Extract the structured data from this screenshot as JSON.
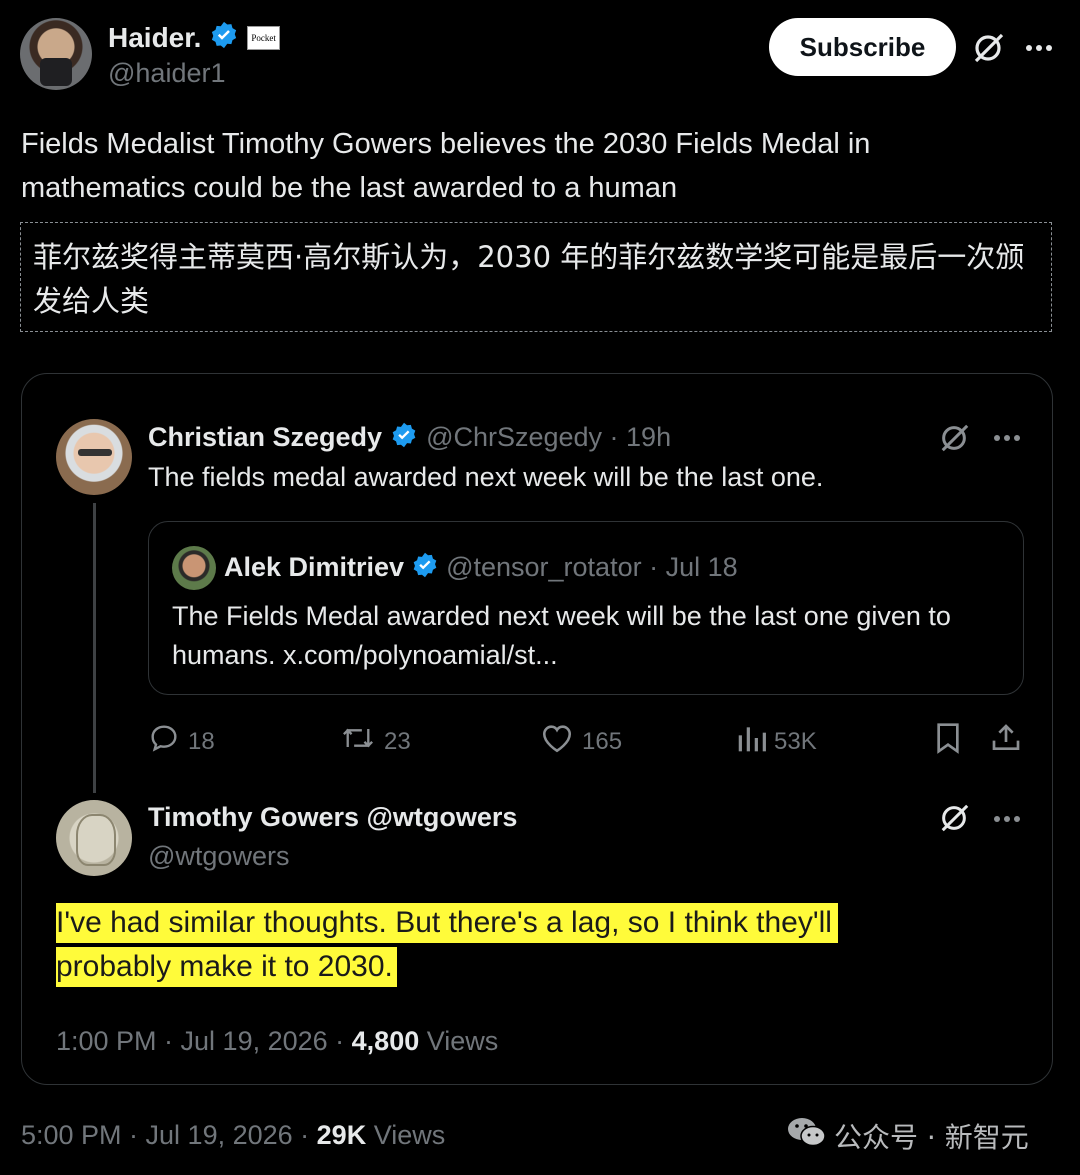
{
  "author": {
    "name": "Haider.",
    "handle": "@haider1",
    "badge_text": "Pocket",
    "subscribe_label": "Subscribe"
  },
  "post": {
    "text_en": "Fields Medalist Timothy Gowers believes the 2030 Fields Medal in mathematics could be the last awarded to a human",
    "text_zh": "菲尔兹奖得主蒂莫西·高尔斯认为，2030 年的菲尔兹数学奖可能是最后一次颁发给人类",
    "footer": {
      "time": "5:00 PM · Jul 19, 2026 · ",
      "views_count": "29K",
      "views_label": " Views"
    }
  },
  "quote": {
    "tweet1": {
      "name": "Christian Szegedy",
      "handle_time": "@ChrSzegedy · 19h",
      "text": "The fields medal awarded next week will be the last one.",
      "nested": {
        "name": "Alek Dimitriev",
        "handle_time": "@tensor_rotator · Jul 18",
        "text": "The Fields Medal awarded next week will be the last one given to humans. x.com/polynoamial/st..."
      },
      "metrics": {
        "replies": "18",
        "reposts": "23",
        "likes": "165",
        "views": "53K"
      }
    },
    "tweet2": {
      "name": "Timothy Gowers @wtgowers",
      "handle": "@wtgowers",
      "text_line1": "I've had similar thoughts. But there's a lag, so I think they'll",
      "text_line2": "probably make it to 2030.",
      "footer_time": "1:00 PM · Jul 19, 2026 · ",
      "views_count": "4,800",
      "views_label": " Views"
    }
  },
  "watermark": {
    "text": "公众号 · 新智元"
  },
  "colors": {
    "background": "#000000",
    "text": "#e7e9ea",
    "muted": "#71767b",
    "verified": "#1d9bf0",
    "highlight": "#fffb3a",
    "border": "#2f3336"
  }
}
